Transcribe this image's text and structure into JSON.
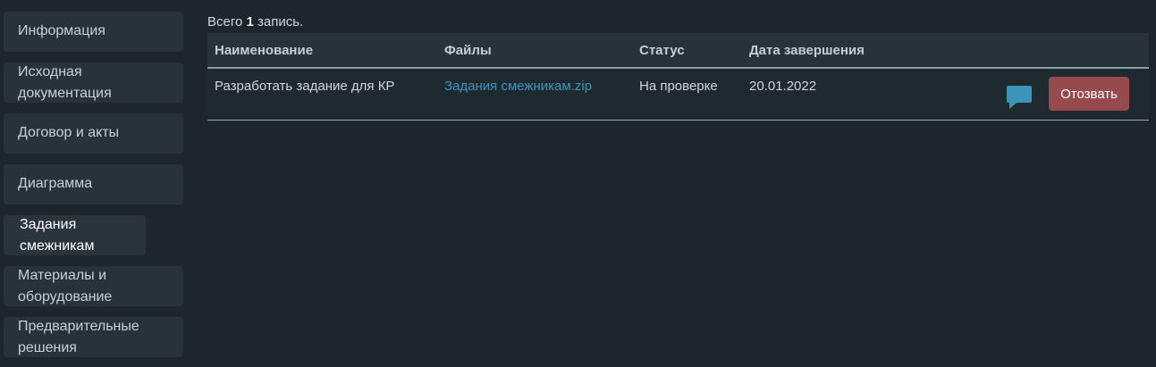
{
  "sidebar": {
    "items": [
      {
        "lines": [
          "Информация"
        ]
      },
      {
        "lines": [
          "Исходная",
          "документация"
        ]
      },
      {
        "lines": [
          "Договор и акты"
        ]
      },
      {
        "lines": [
          "Диаграмма"
        ]
      },
      {
        "lines": [
          "Задания",
          "смежникам"
        ],
        "active": true
      },
      {
        "lines": [
          "Материалы и",
          "оборудование"
        ]
      },
      {
        "lines": [
          "Предварительные",
          "решения"
        ]
      }
    ]
  },
  "summary": {
    "prefix": "Всего",
    "count": "1",
    "suffix": "запись."
  },
  "table": {
    "columns": [
      "Наименование",
      "Файлы",
      "Статус",
      "Дата завершения"
    ],
    "rows": [
      {
        "name": "Разработать задание для КР",
        "file": "Задания смежникам.zip",
        "status": "На проверке",
        "date": "20.01.2022",
        "action_label": "Отозвать"
      }
    ]
  },
  "colors": {
    "background": "#1d262c",
    "panel": "#28323a",
    "link": "#3a95bb",
    "danger_button": "#964a4e",
    "comment_icon": "#3a95bb"
  },
  "icons": {
    "comment": "speech-bubble"
  }
}
